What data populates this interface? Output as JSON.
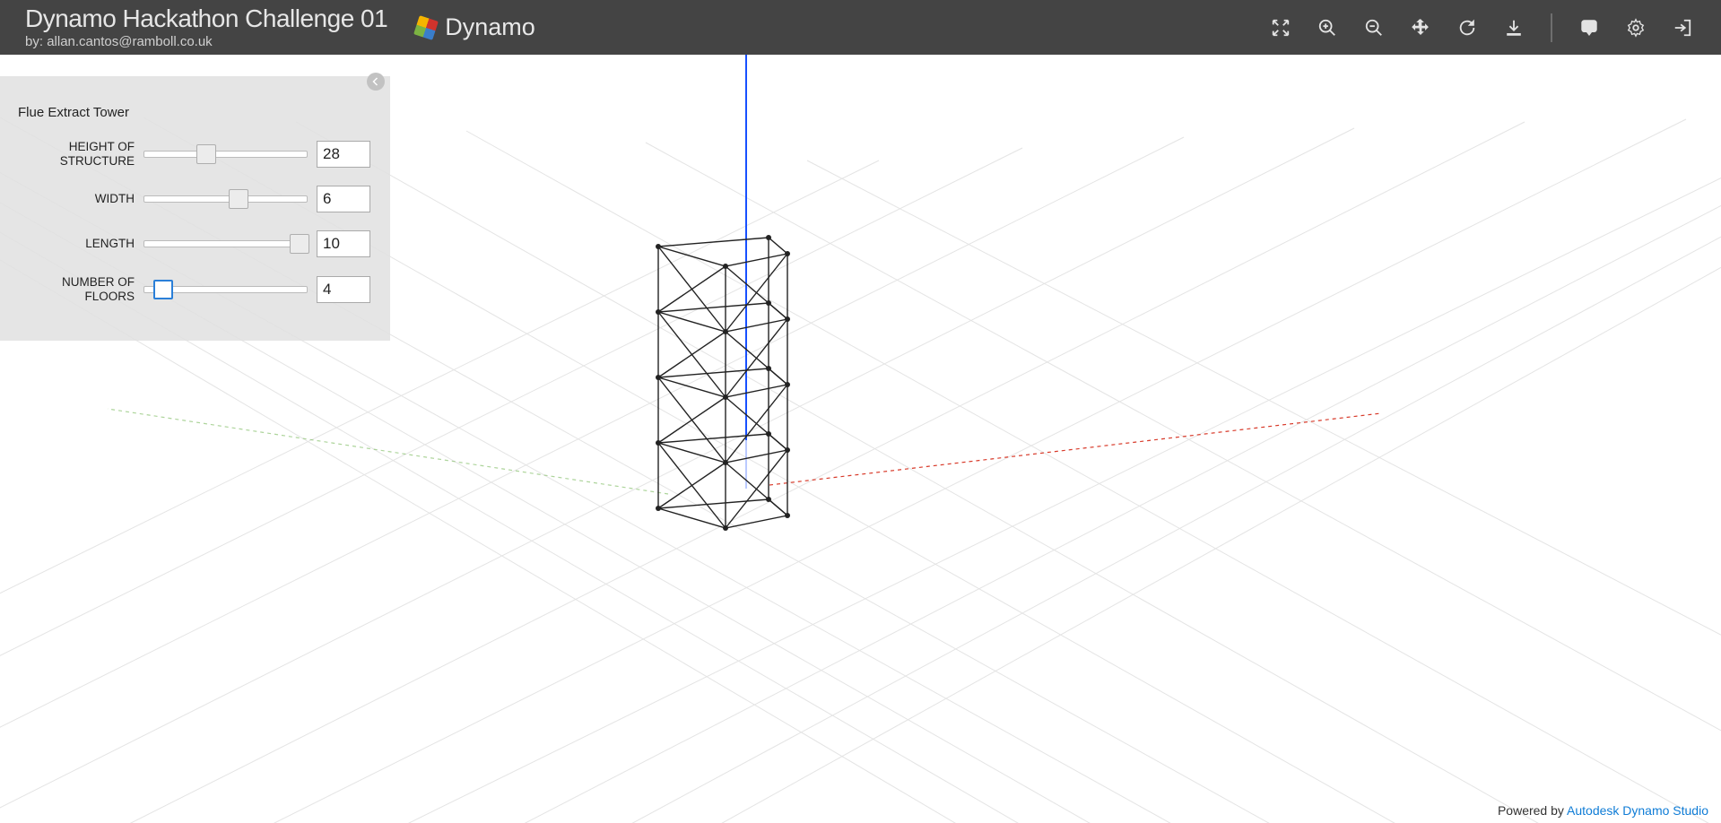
{
  "header": {
    "title": "Dynamo Hackathon Challenge 01",
    "byline_prefix": "by: ",
    "byline_user": "allan.cantos@ramboll.co.uk",
    "brand": "Dynamo"
  },
  "toolbar": {
    "fit": "fit-view-icon",
    "zoom_in": "zoom-in-icon",
    "zoom_out": "zoom-out-icon",
    "pan": "pan-icon",
    "orbit": "orbit-icon",
    "download": "download-icon",
    "comment": "comment-icon",
    "settings": "settings-icon",
    "share": "share-export-icon"
  },
  "panel": {
    "title": "Flue Extract Tower",
    "params": [
      {
        "key": "height",
        "label": "HEIGHT OF STRUCTURE",
        "value": "28",
        "pos": 0.38,
        "active": false
      },
      {
        "key": "width",
        "label": "WIDTH",
        "value": "6",
        "pos": 0.58,
        "active": false
      },
      {
        "key": "length",
        "label": "LENGTH",
        "value": "10",
        "pos": 0.95,
        "active": false
      },
      {
        "key": "floors",
        "label": "NUMBER OF FLOORS",
        "value": "4",
        "pos": 0.12,
        "active": true
      }
    ]
  },
  "footer": {
    "text": "Powered by ",
    "link": "Autodesk Dynamo Studio"
  }
}
